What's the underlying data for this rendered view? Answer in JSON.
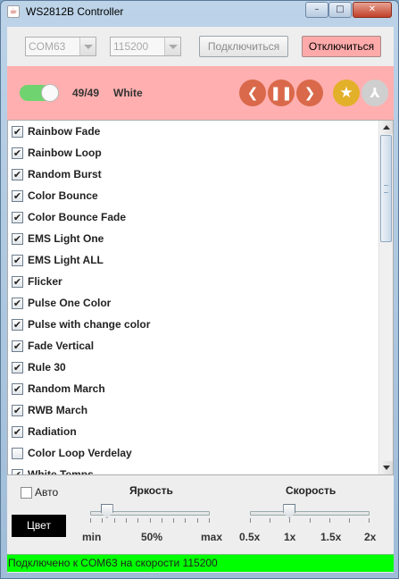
{
  "window": {
    "title": "WS2812B Controller",
    "buttons": {
      "minimize": "–",
      "maximize": "□",
      "close": "✕"
    }
  },
  "toolbar": {
    "port_value": "COM63",
    "baud_value": "115200",
    "connect_label": "Подключиться",
    "disconnect_label": "Отключиться"
  },
  "controls": {
    "power_on": true,
    "counter": "49/49",
    "mode": "White",
    "icons": [
      "prev-icon",
      "pause-icon",
      "next-icon",
      "star-icon",
      "fan-icon"
    ],
    "accent_color": "#ffafaf",
    "button_color": "#d9694a",
    "star_color": "#e3b02a"
  },
  "effects": [
    {
      "label": "Rainbow Fade",
      "checked": true
    },
    {
      "label": "Rainbow Loop",
      "checked": true
    },
    {
      "label": "Random Burst",
      "checked": true
    },
    {
      "label": "Color Bounce",
      "checked": true
    },
    {
      "label": "Color Bounce Fade",
      "checked": true
    },
    {
      "label": "EMS Light One",
      "checked": true
    },
    {
      "label": "EMS Light ALL",
      "checked": true
    },
    {
      "label": "Flicker",
      "checked": true
    },
    {
      "label": "Pulse One Color",
      "checked": true
    },
    {
      "label": "Pulse with change color",
      "checked": true
    },
    {
      "label": "Fade Vertical",
      "checked": true
    },
    {
      "label": "Rule 30",
      "checked": true
    },
    {
      "label": "Random March",
      "checked": true
    },
    {
      "label": "RWB March",
      "checked": true
    },
    {
      "label": "Radiation",
      "checked": true
    },
    {
      "label": "Color Loop Verdelay",
      "checked": false
    },
    {
      "label": "White Temps",
      "checked": true
    }
  ],
  "bottom": {
    "auto_label": "Авто",
    "auto_checked": false,
    "color_button_label": "Цвет",
    "brightness": {
      "title": "Яркость",
      "labels": [
        "min",
        "50%",
        "max"
      ],
      "value_fraction": 0.14
    },
    "speed": {
      "title": "Скорость",
      "labels": [
        "0.5x",
        "1x",
        "1.5x",
        "2x"
      ],
      "value_fraction": 0.33
    }
  },
  "status": {
    "text": "Подключено к COM63 на скорости 115200",
    "color": "#00ff00"
  }
}
